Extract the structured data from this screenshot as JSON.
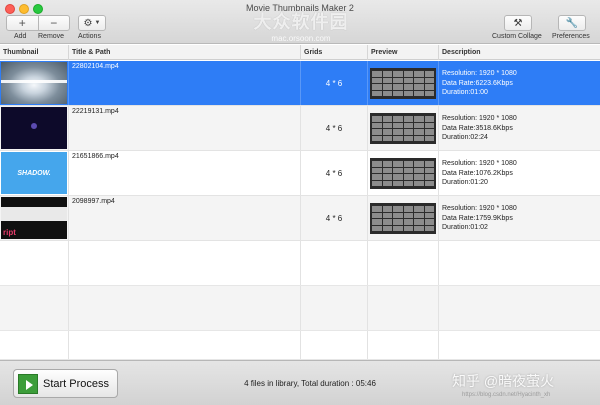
{
  "window": {
    "title": "Movie Thumbnails Maker 2"
  },
  "toolbar": {
    "add_glyph": "+",
    "remove_glyph": "−",
    "add_label": "Add",
    "remove_label": "Remove",
    "actions_label": "Actions",
    "custom_collage_label": "Custom Collage",
    "preferences_label": "Preferences"
  },
  "watermark": {
    "main": "大众软件园",
    "sub": "mac.orsoon.com"
  },
  "columns": [
    "Thumbnail",
    "Title & Path",
    "Grids",
    "Preview",
    "Description"
  ],
  "rows": [
    {
      "title": "22802104.mp4",
      "grids": "4 * 6",
      "resolution": "Resolution: 1920 * 1080",
      "data_rate": "Data Rate:6223.6Kbps",
      "duration": "Duration:01:00"
    },
    {
      "title": "22219131.mp4",
      "grids": "4 * 6",
      "resolution": "Resolution: 1920 * 1080",
      "data_rate": "Data Rate:3518.6Kbps",
      "duration": "Duration:02:24"
    },
    {
      "title": "21651866.mp4",
      "grids": "4 * 6",
      "resolution": "Resolution: 1920 * 1080",
      "data_rate": "Data Rate:1076.2Kbps",
      "duration": "Duration:01:20",
      "thumb_text": "SHADOW."
    },
    {
      "title": "2098997.mp4",
      "grids": "4 * 6",
      "resolution": "Resolution: 1920 * 1080",
      "data_rate": "Data Rate:1759.9Kbps",
      "duration": "Duration:01:02",
      "thumb_text": "ript"
    }
  ],
  "bottom": {
    "start_label": "Start Process",
    "status": "4 files in library, Total duration : 05:46",
    "zhihu": "知乎 @暗夜萤火",
    "blog": "https://blog.csdn.net/Hyacinth_xh"
  },
  "colors": {
    "selection": "#2e7df6"
  }
}
